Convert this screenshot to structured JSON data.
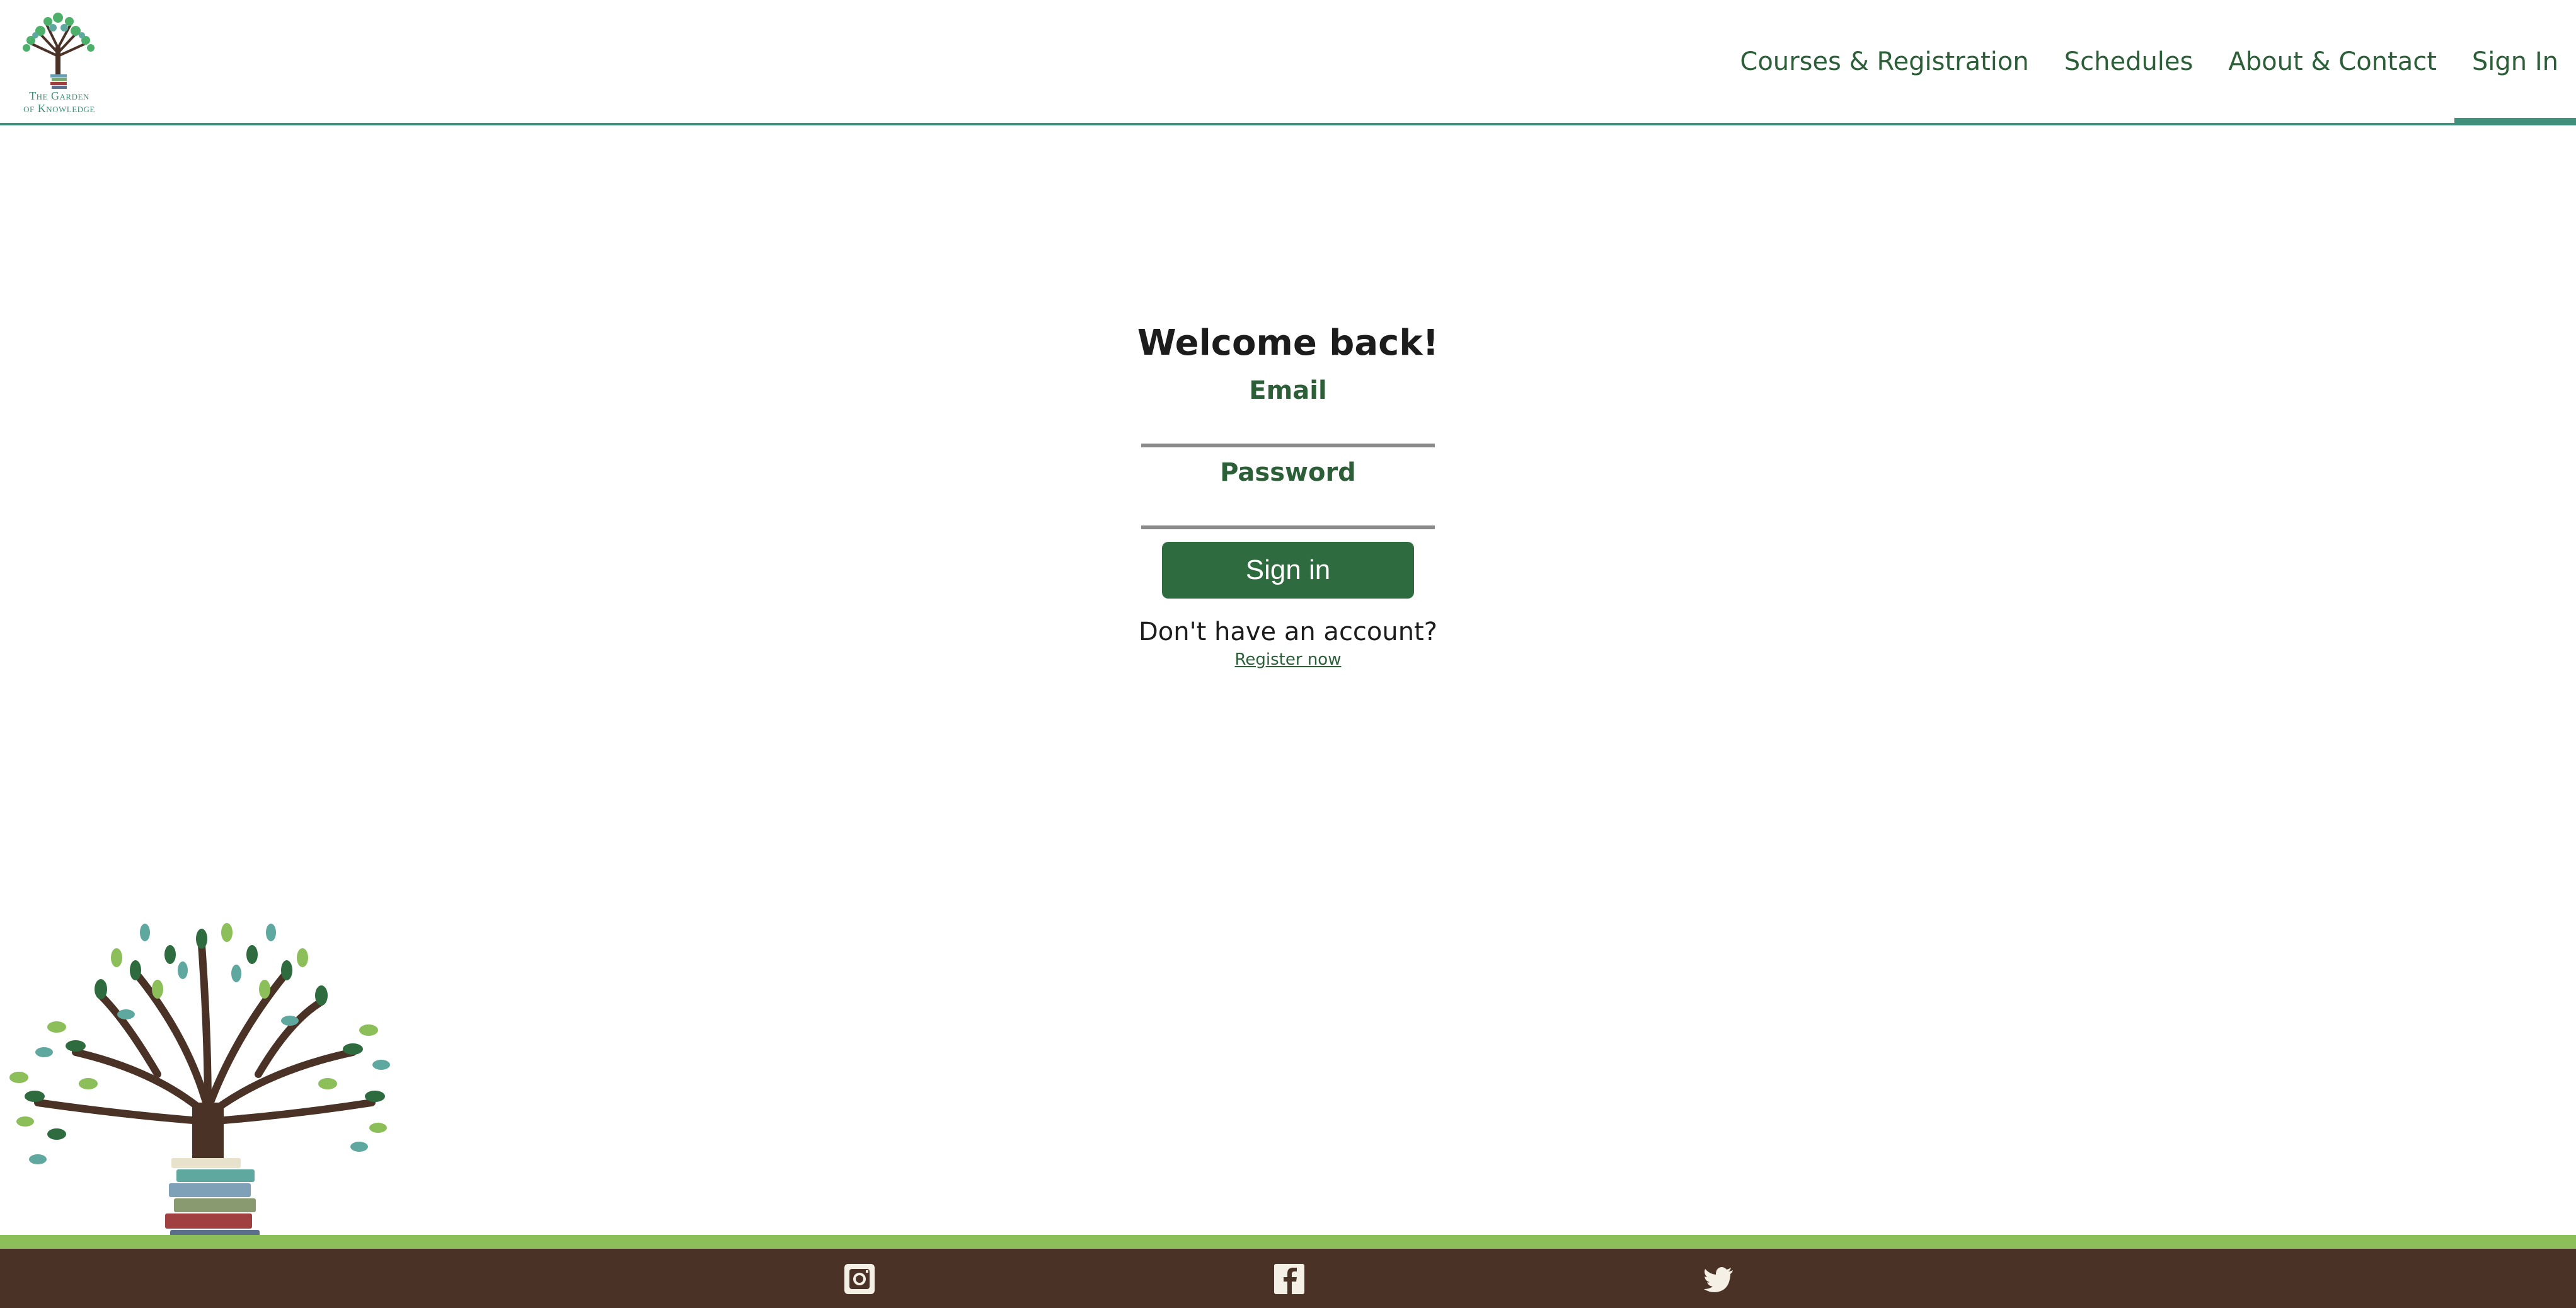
{
  "brand": {
    "line1": "The Garden",
    "line2": "of Knowledge"
  },
  "nav": {
    "items": [
      {
        "label": "Courses & Registration",
        "name": "nav-courses-registration"
      },
      {
        "label": "Schedules",
        "name": "nav-schedules"
      },
      {
        "label": "About & Contact",
        "name": "nav-about-contact"
      },
      {
        "label": "Sign In",
        "name": "nav-sign-in",
        "active": true
      }
    ]
  },
  "form": {
    "title": "Welcome back!",
    "email_label": "Email",
    "email_value": "",
    "password_label": "Password",
    "password_value": "",
    "submit_label": "Sign in",
    "no_account_text": "Don't have an account?",
    "register_label": "Register now"
  },
  "footer": {
    "icons": [
      "instagram-icon",
      "facebook-icon",
      "twitter-icon"
    ]
  },
  "colors": {
    "primary_green": "#2e6b3e",
    "teal": "#3f8f7a",
    "footer_brown": "#4a3226",
    "footer_strip": "#8cbf5a"
  }
}
